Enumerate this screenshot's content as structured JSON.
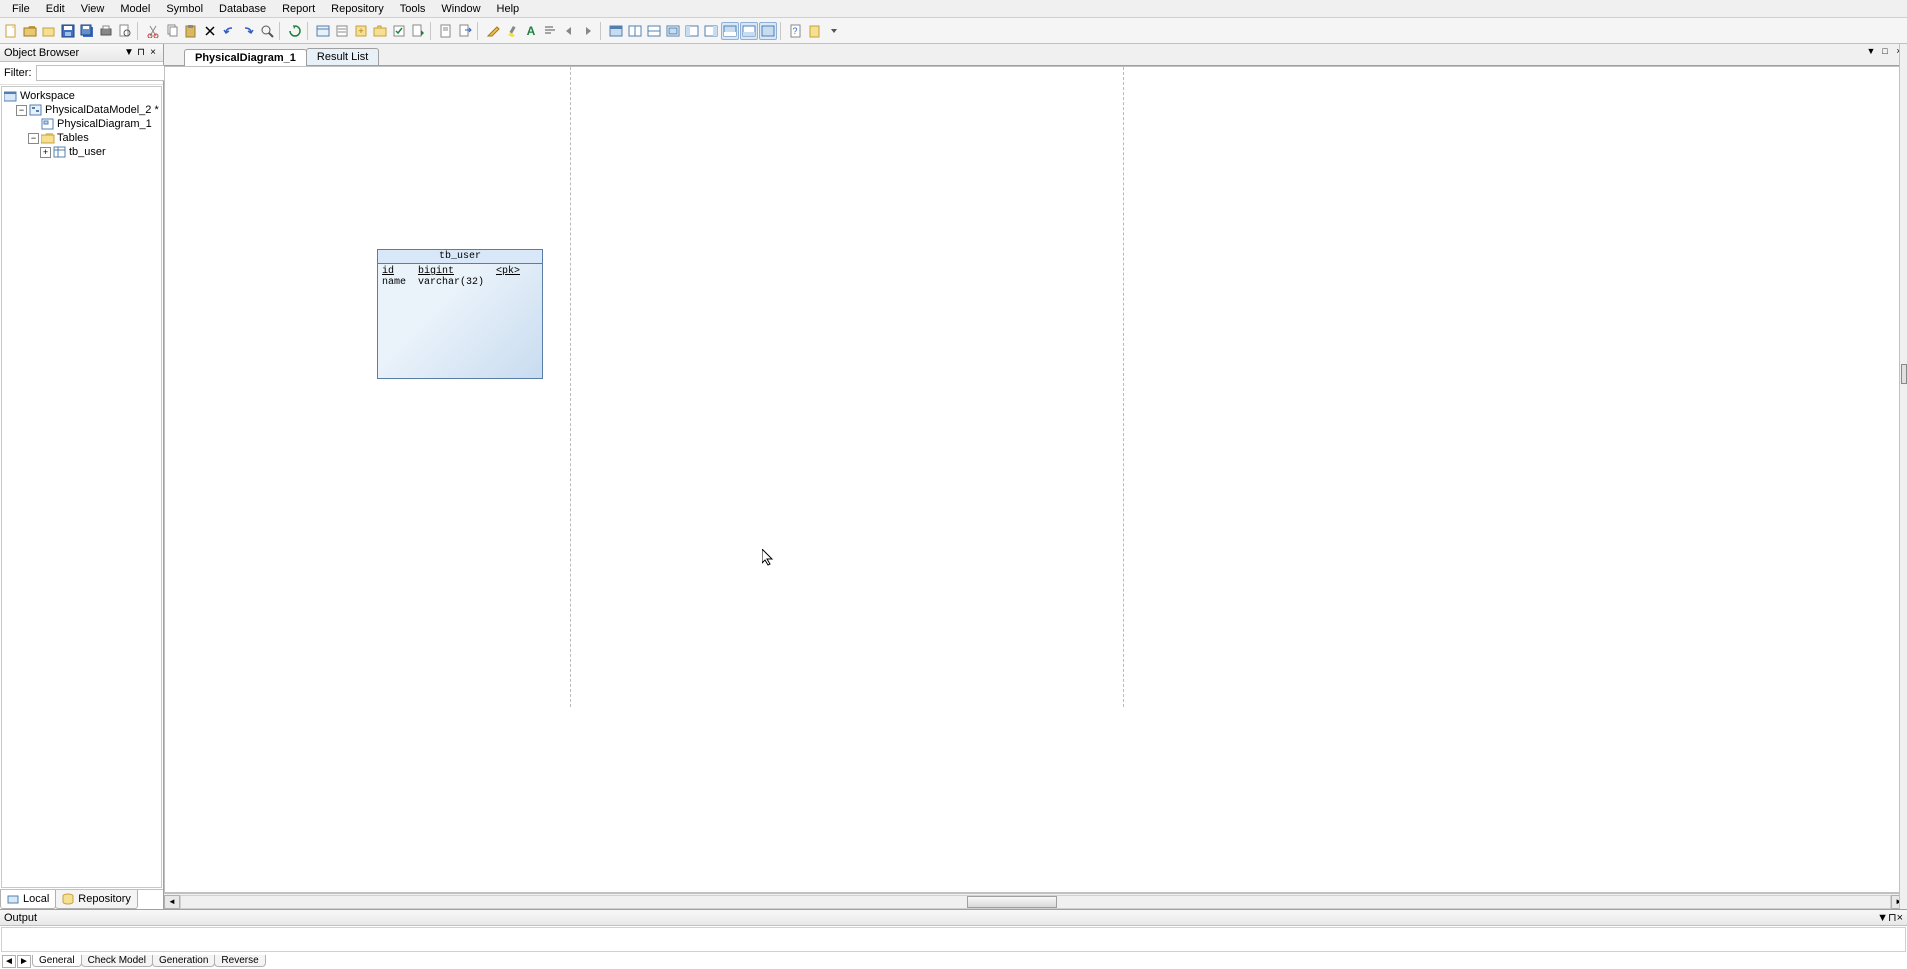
{
  "menu": [
    "File",
    "Edit",
    "View",
    "Model",
    "Symbol",
    "Database",
    "Report",
    "Repository",
    "Tools",
    "Window",
    "Help"
  ],
  "browser": {
    "title": "Object Browser",
    "filter_label": "Filter:",
    "filter_value": "",
    "tree": {
      "root": "Workspace",
      "model": "PhysicalDataModel_2 *",
      "diagram": "PhysicalDiagram_1",
      "tables_folder": "Tables",
      "table": "tb_user"
    },
    "tabs": {
      "local": "Local",
      "repository": "Repository"
    }
  },
  "doc_tabs": {
    "active": "PhysicalDiagram_1",
    "other": "Result List"
  },
  "entity": {
    "name": "tb_user",
    "columns": [
      {
        "name": "id",
        "type": "bigint",
        "key": "<pk>"
      },
      {
        "name": "name",
        "type": "varchar(32)",
        "key": ""
      }
    ]
  },
  "output": {
    "title": "Output",
    "tabs": [
      "General",
      "Check Model",
      "Generation",
      "Reverse"
    ]
  }
}
